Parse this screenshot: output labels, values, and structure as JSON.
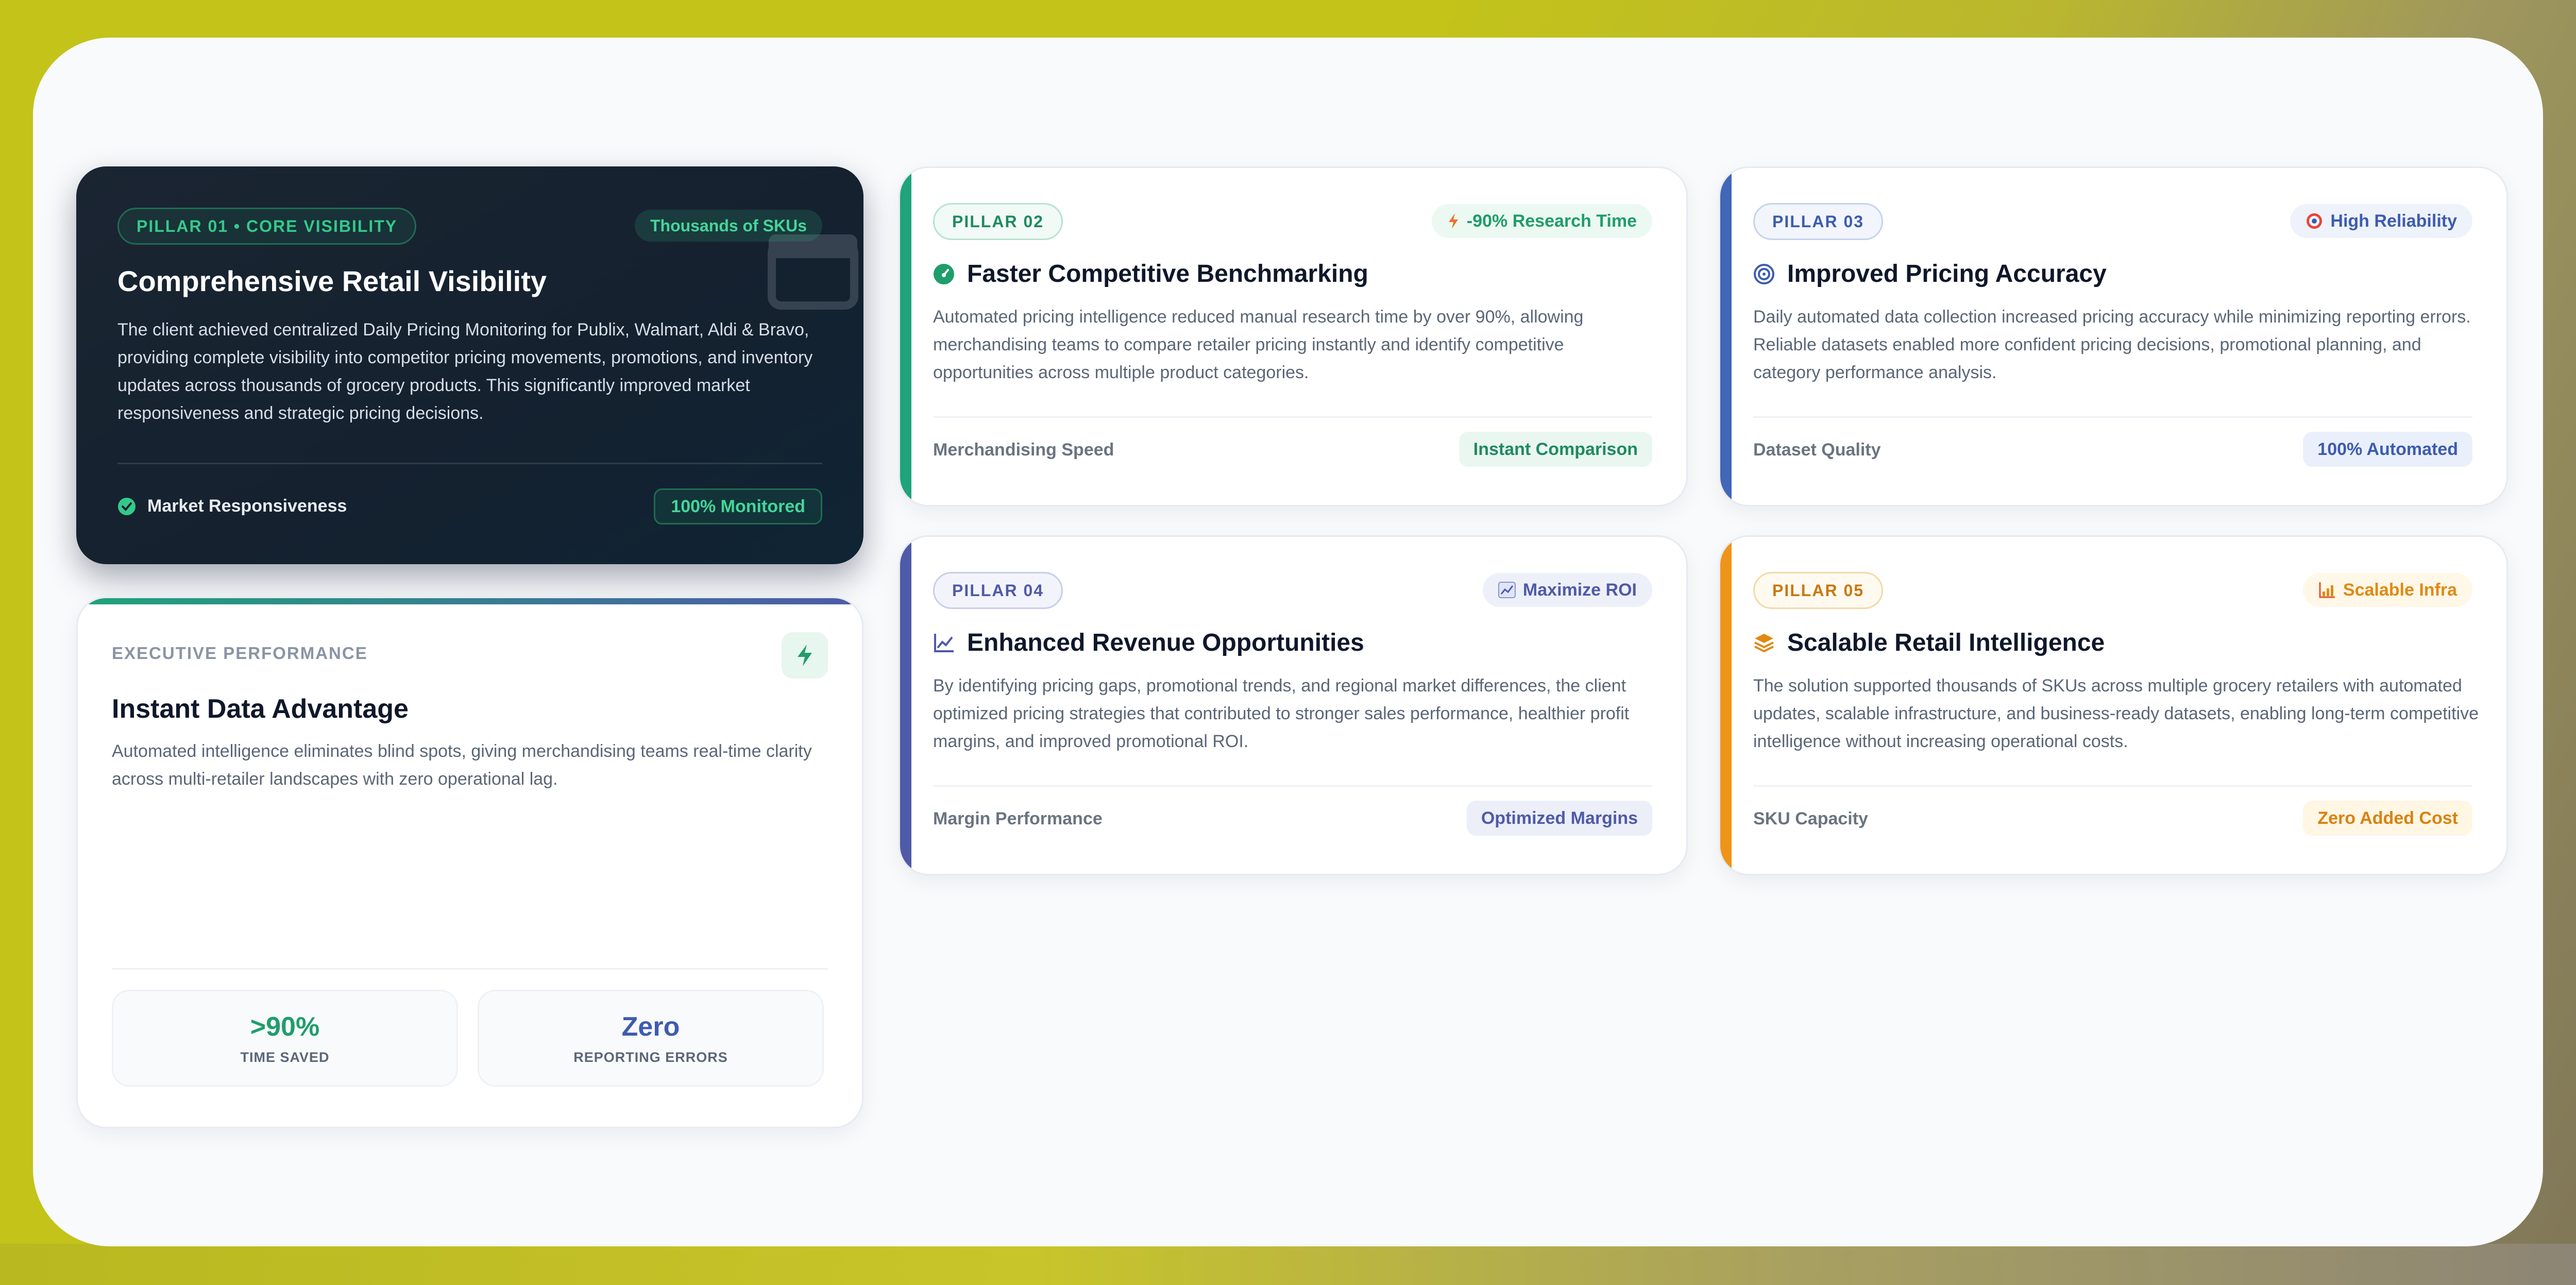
{
  "colors": {
    "green": "#1f9d6b",
    "blue": "#3d5bb0",
    "indigo": "#4f5aa8",
    "orange": "#e08a12",
    "dark_bg": "#16202d"
  },
  "pillar1": {
    "tag": "PILLAR 01 • CORE VISIBILITY",
    "badge": "Thousands of SKUs",
    "title": "Comprehensive Retail Visibility",
    "desc": "The client achieved centralized Daily Pricing Monitoring for Publix, Walmart, Aldi & Bravo, providing complete visibility into competitor pricing movements, promotions, and inventory updates across thousands of grocery products. This significantly improved market responsiveness and strategic pricing decisions.",
    "foot_label": "Market Responsiveness",
    "foot_badge": "100% Monitored",
    "icon": "store-icon"
  },
  "executive": {
    "eyebrow": "EXECUTIVE PERFORMANCE",
    "title": "Instant Data Advantage",
    "desc": "Automated intelligence eliminates blind spots, giving merchandising teams real-time clarity across multi-retailer landscapes with zero operational lag.",
    "icon": "bolt-icon",
    "stats": [
      {
        "value": ">90%",
        "label": "TIME SAVED"
      },
      {
        "value": "Zero",
        "label": "REPORTING ERRORS"
      }
    ]
  },
  "pillar2": {
    "tag": "PILLAR 02",
    "badge": "-90% Research Time",
    "badge_icon": "lightning-icon",
    "title": "Faster Competitive Benchmarking",
    "title_icon": "speedometer-icon",
    "desc": "Automated pricing intelligence reduced manual research time by over 90%, allowing merchandising teams to compare retailer pricing instantly and identify competitive opportunities across multiple product categories.",
    "foot_label": "Merchandising Speed",
    "foot_badge": "Instant Comparison"
  },
  "pillar3": {
    "tag": "PILLAR 03",
    "badge": "High Reliability",
    "badge_icon": "target-icon",
    "title": "Improved Pricing Accuracy",
    "title_icon": "bullseye-icon",
    "desc": "Daily automated data collection increased pricing accuracy while minimizing reporting errors. Reliable datasets enabled more confident pricing decisions, promotional planning, and category performance analysis.",
    "foot_label": "Dataset Quality",
    "foot_badge": "100% Automated"
  },
  "pillar4": {
    "tag": "PILLAR 04",
    "badge": "Maximize ROI",
    "badge_icon": "chart-up-icon",
    "title": "Enhanced Revenue Opportunities",
    "title_icon": "line-chart-icon",
    "desc": "By identifying pricing gaps, promotional trends, and regional market differences, the client optimized pricing strategies that contributed to stronger sales performance, healthier profit margins, and improved promotional ROI.",
    "foot_label": "Margin Performance",
    "foot_badge": "Optimized Margins"
  },
  "pillar5": {
    "tag": "PILLAR 05",
    "badge": "Scalable Infra",
    "badge_icon": "bar-growth-icon",
    "title": "Scalable Retail Intelligence",
    "title_icon": "layers-icon",
    "desc": "The solution supported thousands of SKUs across multiple grocery retailers with automated updates, scalable infrastructure, and business-ready datasets, enabling long-term competitive intelligence without increasing operational costs.",
    "foot_label": "SKU Capacity",
    "foot_badge": "Zero Added Cost"
  }
}
